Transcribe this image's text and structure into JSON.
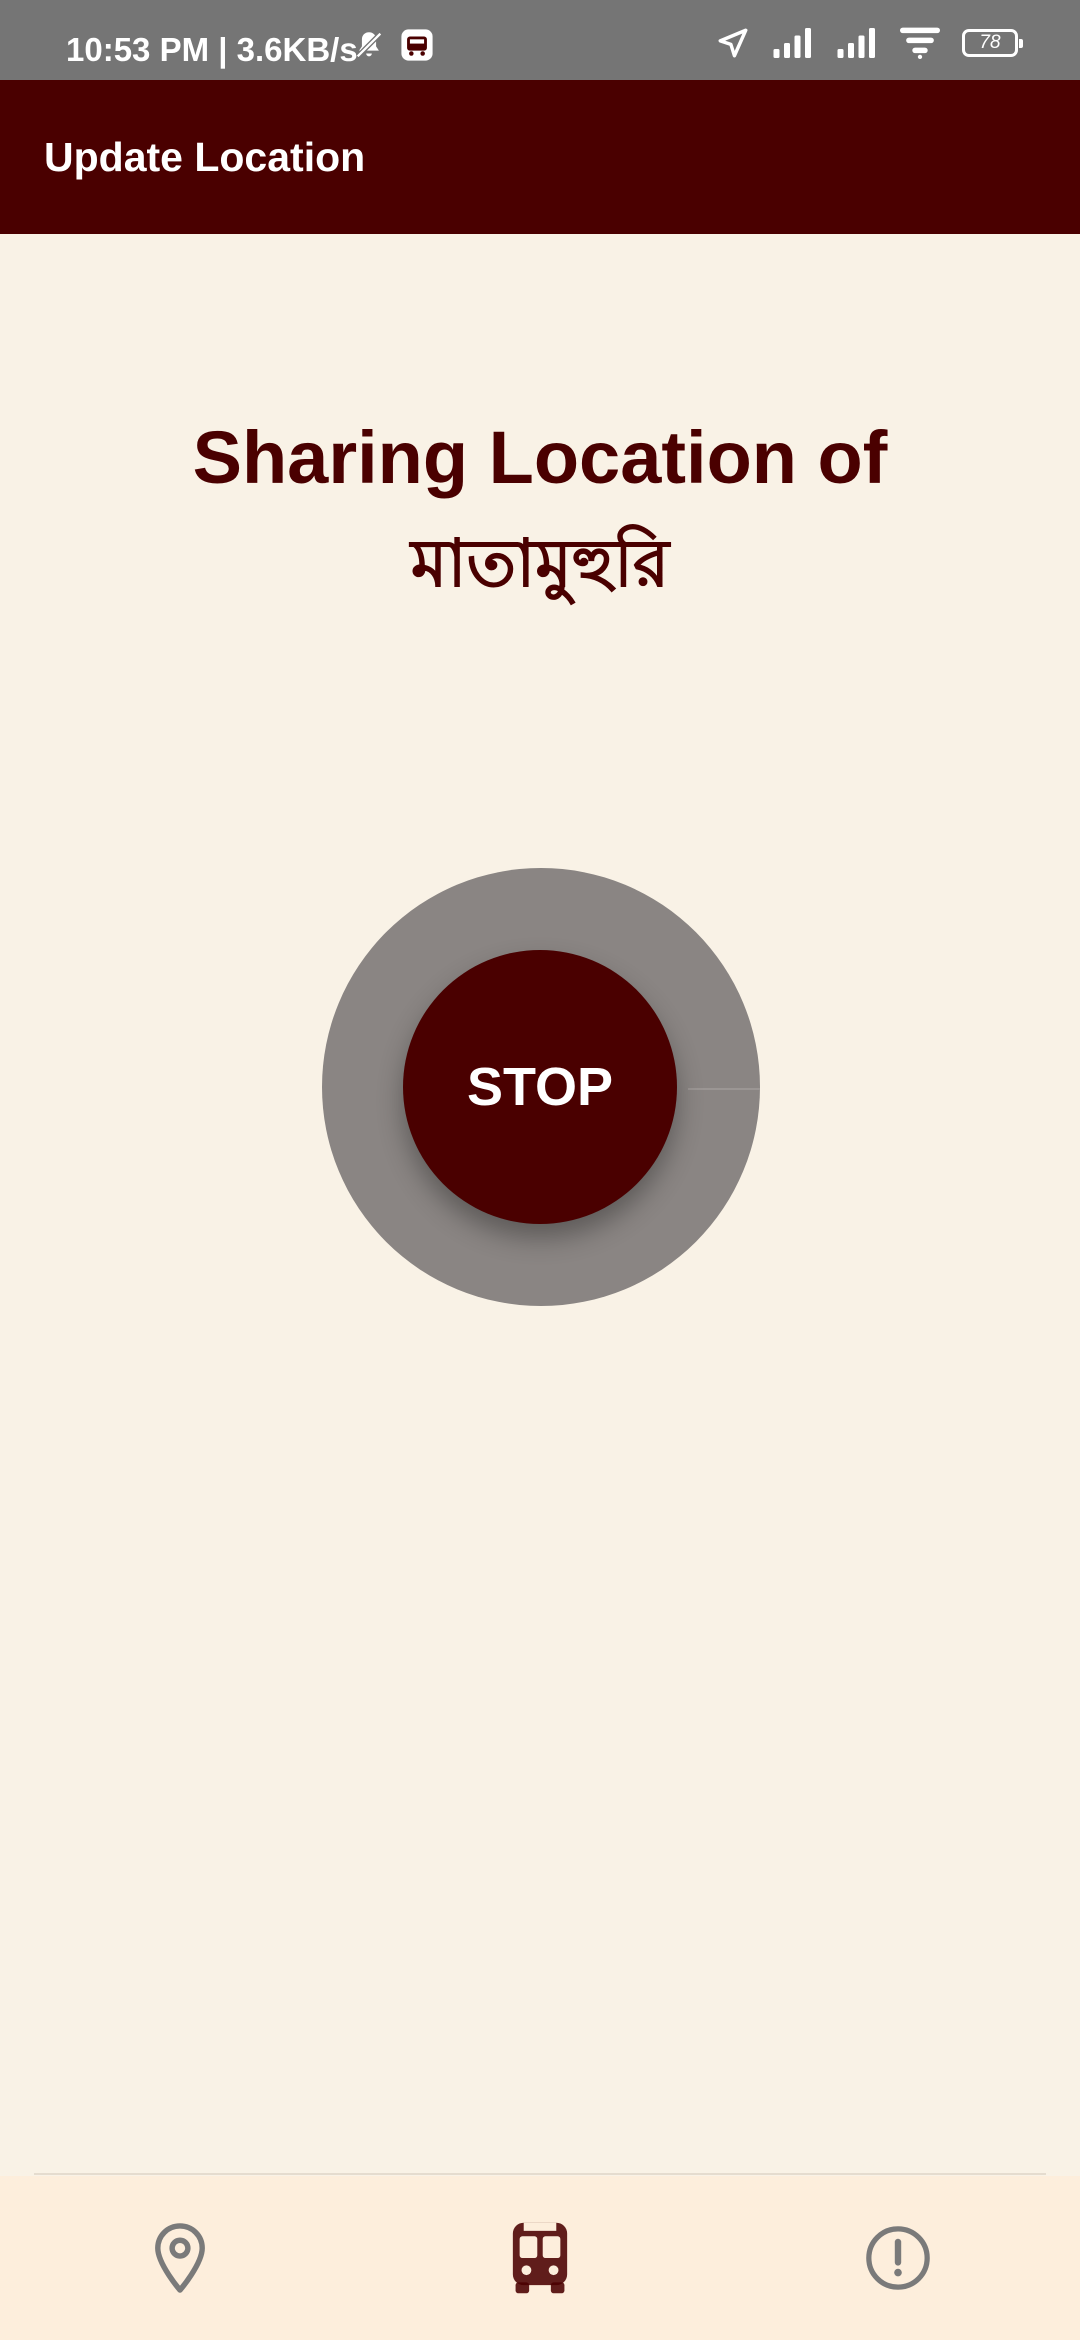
{
  "status_bar": {
    "time_speed": "10:53 PM | 3.6KB/s",
    "battery_level": "78"
  },
  "app_bar": {
    "title": "Update Location"
  },
  "main": {
    "heading_line1": "Sharing Location of",
    "heading_line2": "মাতামুহুরি",
    "stop_label": "STOP"
  },
  "colors": {
    "primary": "#4a0000",
    "background": "#f9f2e6",
    "ring": "#8a8583",
    "nav_background": "#fdeedc",
    "nav_icon_inactive": "#7a7a7a",
    "status_bar": "#757575"
  },
  "bottom_nav": {
    "items": [
      {
        "icon": "location-pin-icon",
        "active": false
      },
      {
        "icon": "bus-icon",
        "active": true
      },
      {
        "icon": "alert-circle-icon",
        "active": false
      }
    ]
  }
}
